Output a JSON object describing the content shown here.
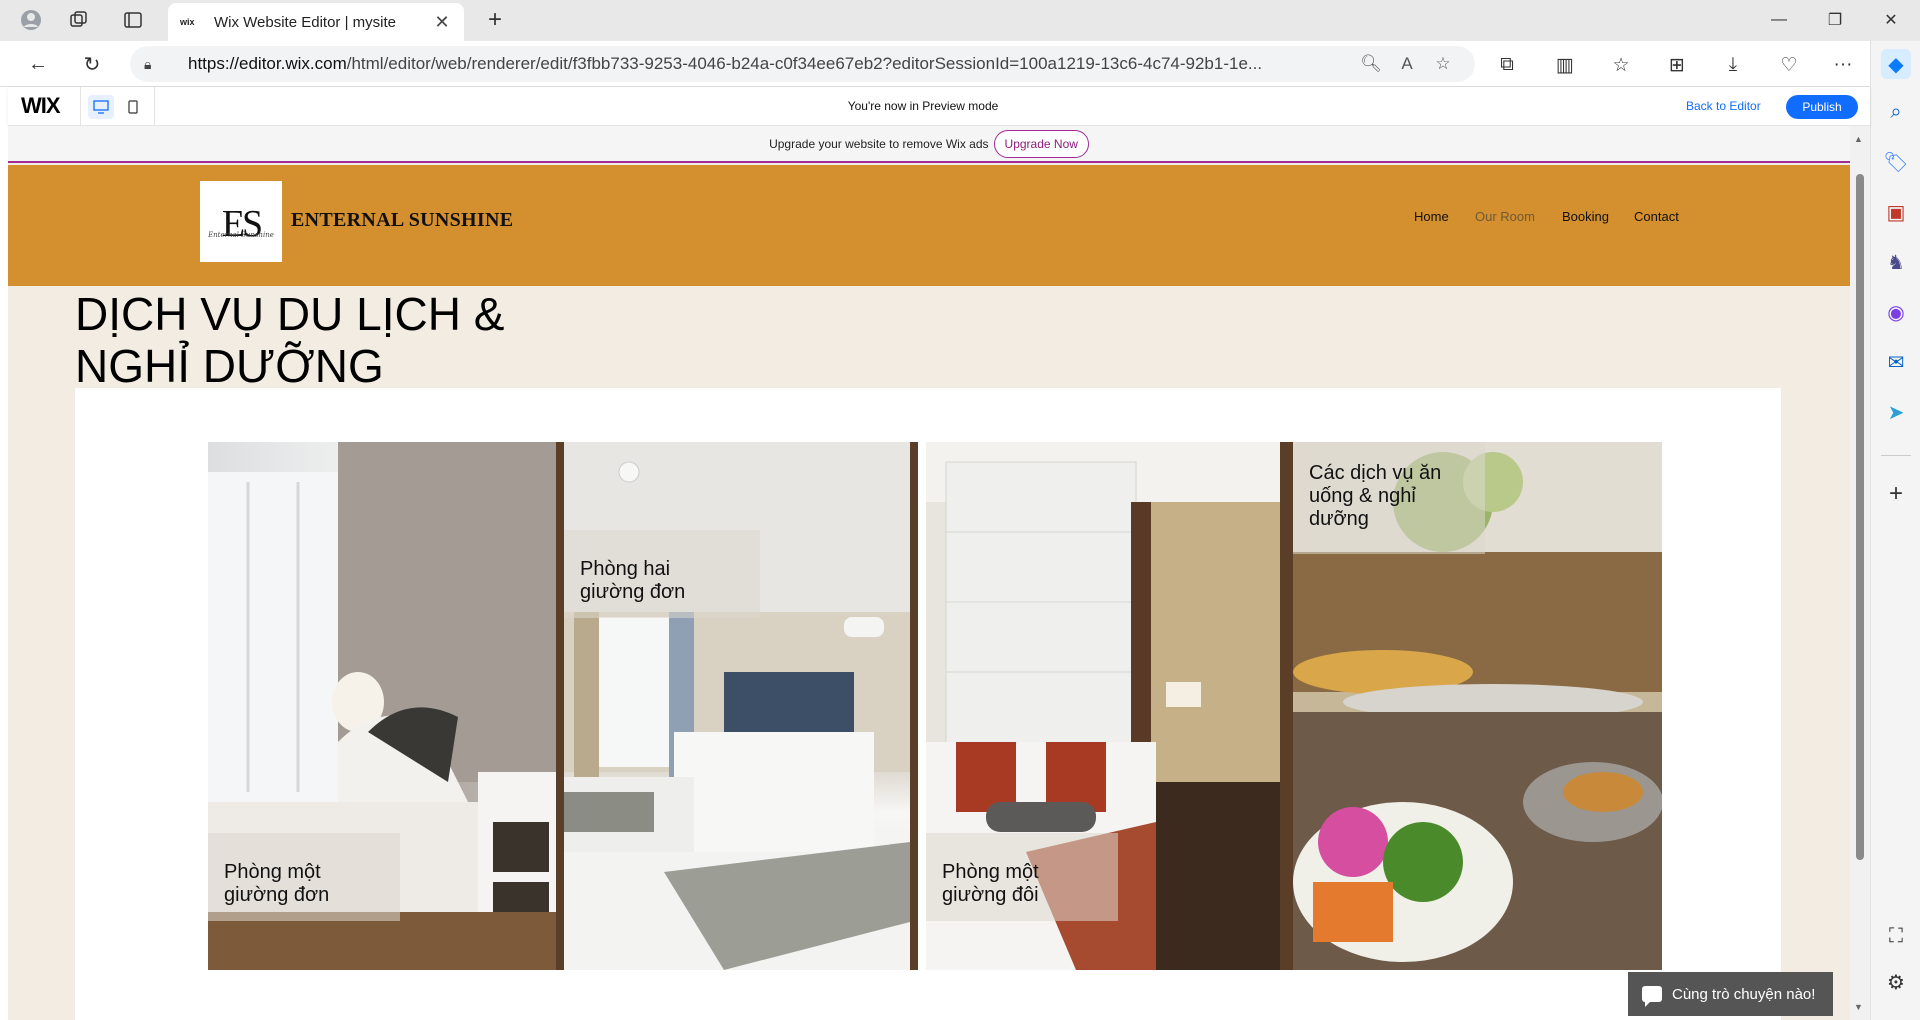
{
  "browser": {
    "tab_title": "Wix Website Editor | mysite",
    "tab_favicon": "wix",
    "url_host": "https://editor.wix.com",
    "url_path": "/html/editor/web/renderer/edit/f3fbb733-9253-4046-b24a-c0f34ee67eb2?editorSessionId=100a1219-13c6-4c74-92b1-1e..."
  },
  "wix_bar": {
    "logo": "WIX",
    "preview_message": "You're now in Preview mode",
    "back_label": "Back to Editor",
    "publish_label": "Publish"
  },
  "ad_banner": {
    "text": "Upgrade your website to remove Wix ads",
    "button": "Upgrade Now"
  },
  "site": {
    "logo_mono": "ES",
    "logo_sub": "Enternal Sunshine",
    "brand": "ENTERNAL SUNSHINE",
    "nav": [
      "Home",
      "Our Room",
      "Booking",
      "Contact"
    ],
    "active_nav": "Our Room",
    "title_line1": "DỊCH VỤ DU LỊCH &",
    "title_line2": "NGHỈ DƯỠNG",
    "cards": [
      {
        "caption_l1": "Phòng một",
        "caption_l2": "giường đơn",
        "caption_l3": ""
      },
      {
        "caption_l1": "Phòng hai",
        "caption_l2": "giường đơn",
        "caption_l3": ""
      },
      {
        "caption_l1": "Phòng một",
        "caption_l2": "giường đôi",
        "caption_l3": ""
      },
      {
        "caption_l1": "Các dịch vụ ăn",
        "caption_l2": "uống & nghỉ",
        "caption_l3": "dưỡng"
      }
    ],
    "chat_label": "Cùng trò chuyện nào!"
  },
  "colors": {
    "header_bg": "#d48f2f",
    "page_bg": "#f3ece2",
    "wix_blue": "#116dff",
    "upgrade_accent": "#a02b93"
  },
  "icons": [
    "profile-icon",
    "workspaces-icon",
    "tab-actions-icon",
    "close-icon",
    "new-tab-icon",
    "back-icon",
    "refresh-icon",
    "lock-icon",
    "zoom-icon",
    "read-aloud-icon",
    "favorite-icon",
    "extensions-icon",
    "split-screen-icon",
    "favorites-icon",
    "collections-icon",
    "downloads-icon",
    "browser-essentials-icon",
    "more-icon",
    "copilot-icon",
    "search-icon",
    "shopping-icon",
    "tools-icon",
    "games-icon",
    "office-icon",
    "outlook-icon",
    "telegram-icon",
    "add-icon",
    "screenshot-icon",
    "settings-icon",
    "desktop-icon",
    "mobile-icon",
    "chat-icon"
  ]
}
